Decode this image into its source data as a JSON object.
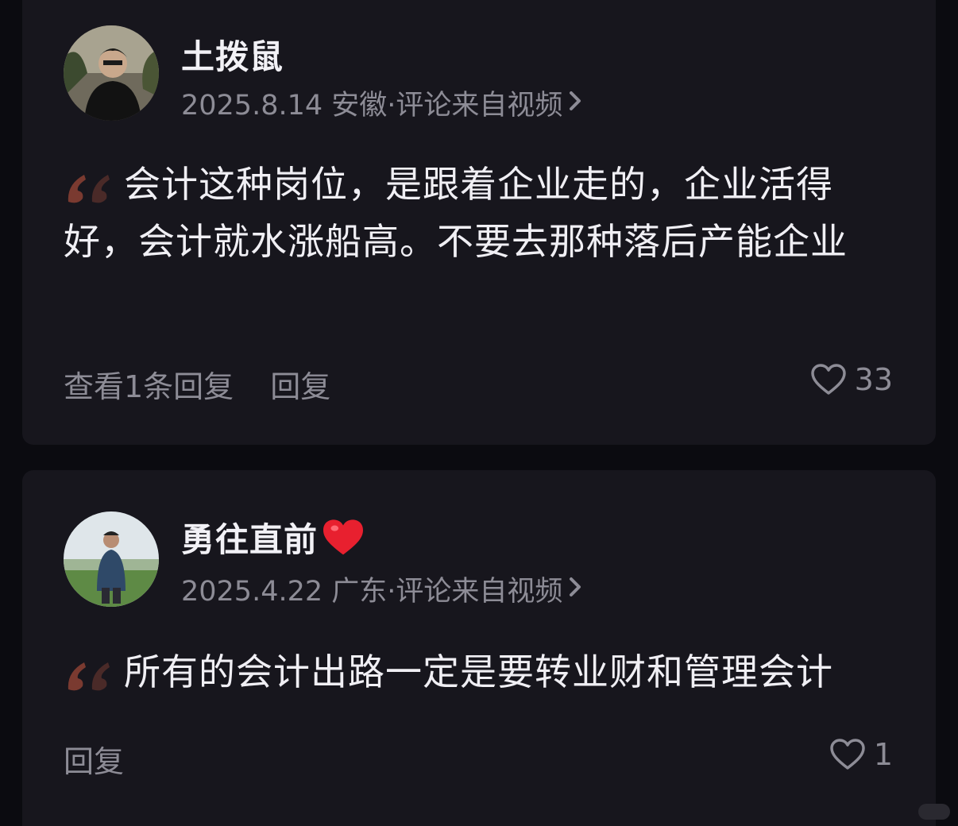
{
  "comments": [
    {
      "username": "土拨鼠",
      "meta": "2025.8.14 安徽·评论来自视频",
      "text": "会计这种岗位，是跟着企业走的，企业活得好，会计就水涨船高。不要去那种落后产能企业",
      "actions": [
        "查看1条回复",
        "回复"
      ],
      "likes": "33"
    },
    {
      "username": "勇往直前",
      "username_emoji": "❤️",
      "meta": "2025.4.22 广东·评论来自视频",
      "text": "所有的会计出路一定是要转业财和管理会计",
      "actions": [
        "回复"
      ],
      "likes": "1"
    }
  ],
  "colors": {
    "background": "#0b0b10",
    "card": "#17161d",
    "text": "#f0eff4",
    "muted": "#8d8c96",
    "quote": "#7a3a30",
    "heart": "#e8202f"
  },
  "icons": {
    "quote": "quote-icon",
    "chevron": "chevron-right-icon",
    "like": "heart-outline-icon",
    "emoji": "red-heart-icon"
  }
}
